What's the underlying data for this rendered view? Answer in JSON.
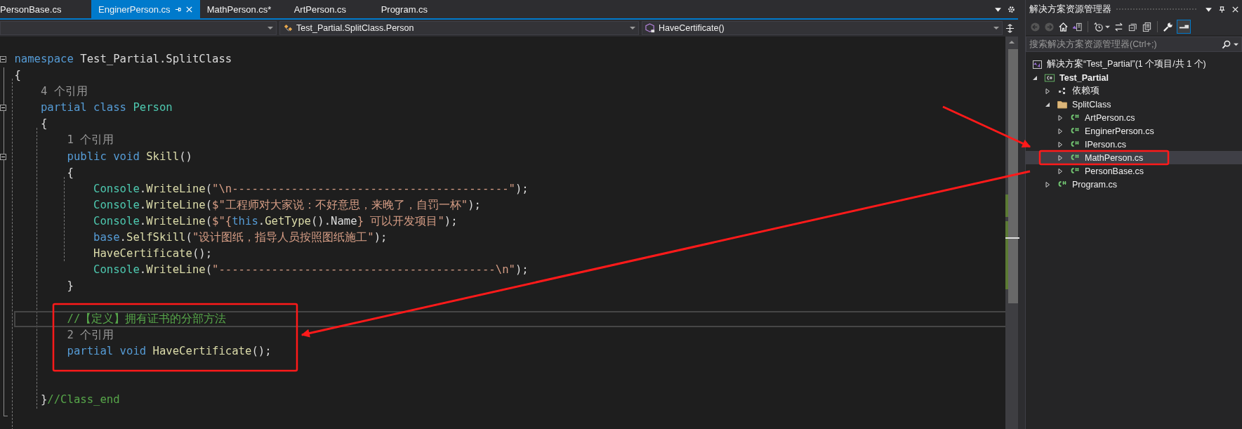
{
  "editor": {
    "tabs": [
      {
        "label": "PersonBase.cs",
        "selected": false
      },
      {
        "label": "EnginerPerson.cs",
        "selected": true
      },
      {
        "label": "MathPerson.cs*",
        "selected": false
      },
      {
        "label": "ArtPerson.cs",
        "selected": false
      },
      {
        "label": "Program.cs",
        "selected": false
      }
    ],
    "nav_bar": {
      "type": "Test_Partial.SplitClass.Person",
      "member": "HaveCertificate()"
    },
    "lines": [
      {
        "kind": "code",
        "fold": true,
        "current": false,
        "segments": [
          {
            "text": "namespace",
            "kind": "keyword"
          },
          {
            "text": " Test_Partial.SplitClass",
            "kind": "plain"
          }
        ]
      },
      {
        "kind": "code",
        "fold": false,
        "current": false,
        "segments": [
          {
            "text": "{",
            "kind": "plain"
          }
        ]
      },
      {
        "kind": "codelens",
        "fold": false,
        "current": false,
        "segments": [
          {
            "text": "    4 个引用",
            "kind": "lens"
          }
        ]
      },
      {
        "kind": "code",
        "fold": true,
        "current": false,
        "segments": [
          {
            "text": "    partial class",
            "kind": "keyword"
          },
          {
            "text": " Person",
            "kind": "type"
          }
        ]
      },
      {
        "kind": "code",
        "fold": false,
        "current": false,
        "segments": [
          {
            "text": "    {",
            "kind": "plain"
          }
        ]
      },
      {
        "kind": "codelens",
        "fold": false,
        "current": false,
        "segments": [
          {
            "text": "        1 个引用",
            "kind": "lens"
          }
        ]
      },
      {
        "kind": "code",
        "fold": true,
        "current": false,
        "segments": [
          {
            "text": "        public void",
            "kind": "keyword"
          },
          {
            "text": " Skill",
            "kind": "method"
          },
          {
            "text": "()",
            "kind": "plain"
          }
        ]
      },
      {
        "kind": "code",
        "fold": false,
        "current": false,
        "segments": [
          {
            "text": "        {",
            "kind": "plain"
          }
        ]
      },
      {
        "kind": "code",
        "fold": false,
        "current": false,
        "segments": [
          {
            "text": "            Console",
            "kind": "type"
          },
          {
            "text": ".",
            "kind": "plain"
          },
          {
            "text": "WriteLine",
            "kind": "method"
          },
          {
            "text": "(",
            "kind": "plain"
          },
          {
            "text": "\"\\n------------------------------------------\"",
            "kind": "string"
          },
          {
            "text": ");",
            "kind": "plain"
          }
        ]
      },
      {
        "kind": "code",
        "fold": false,
        "current": false,
        "segments": [
          {
            "text": "            Console",
            "kind": "type"
          },
          {
            "text": ".",
            "kind": "plain"
          },
          {
            "text": "WriteLine",
            "kind": "method"
          },
          {
            "text": "(",
            "kind": "plain"
          },
          {
            "text": "$\"工程师对大家说：不好意思，来晚了，自罚一杯\"",
            "kind": "string"
          },
          {
            "text": ");",
            "kind": "plain"
          }
        ]
      },
      {
        "kind": "code",
        "fold": false,
        "current": false,
        "segments": [
          {
            "text": "            Console",
            "kind": "type"
          },
          {
            "text": ".",
            "kind": "plain"
          },
          {
            "text": "WriteLine",
            "kind": "method"
          },
          {
            "text": "(",
            "kind": "plain"
          },
          {
            "text": "$\"{",
            "kind": "string"
          },
          {
            "text": "this",
            "kind": "keyword"
          },
          {
            "text": ".",
            "kind": "plain"
          },
          {
            "text": "GetType",
            "kind": "method"
          },
          {
            "text": "().Name",
            "kind": "plain"
          },
          {
            "text": "} 可以开发项目\"",
            "kind": "string"
          },
          {
            "text": ");",
            "kind": "plain"
          }
        ]
      },
      {
        "kind": "code",
        "fold": false,
        "current": false,
        "segments": [
          {
            "text": "            base",
            "kind": "keyword"
          },
          {
            "text": ".",
            "kind": "plain"
          },
          {
            "text": "SelfSkill",
            "kind": "method"
          },
          {
            "text": "(",
            "kind": "plain"
          },
          {
            "text": "\"设计图纸，指导人员按照图纸施工\"",
            "kind": "string"
          },
          {
            "text": ");",
            "kind": "plain"
          }
        ]
      },
      {
        "kind": "code",
        "fold": false,
        "current": false,
        "segments": [
          {
            "text": "            HaveCertificate",
            "kind": "method"
          },
          {
            "text": "();",
            "kind": "plain"
          }
        ]
      },
      {
        "kind": "code",
        "fold": false,
        "current": false,
        "segments": [
          {
            "text": "            Console",
            "kind": "type"
          },
          {
            "text": ".",
            "kind": "plain"
          },
          {
            "text": "WriteLine",
            "kind": "method"
          },
          {
            "text": "(",
            "kind": "plain"
          },
          {
            "text": "\"------------------------------------------\\n\"",
            "kind": "string"
          },
          {
            "text": ");",
            "kind": "plain"
          }
        ]
      },
      {
        "kind": "code",
        "fold": false,
        "current": false,
        "segments": [
          {
            "text": "        }",
            "kind": "plain"
          }
        ]
      },
      {
        "kind": "blank"
      },
      {
        "kind": "code",
        "fold": false,
        "current": true,
        "segments": [
          {
            "text": "        //【定义】拥有证书的分部方法",
            "kind": "comment"
          }
        ]
      },
      {
        "kind": "codelens",
        "fold": false,
        "current": false,
        "segments": [
          {
            "text": "        2 个引用",
            "kind": "lens"
          }
        ]
      },
      {
        "kind": "code",
        "fold": false,
        "current": false,
        "segments": [
          {
            "text": "        partial void",
            "kind": "keyword"
          },
          {
            "text": " HaveCertificate",
            "kind": "method"
          },
          {
            "text": "();",
            "kind": "plain"
          }
        ]
      },
      {
        "kind": "blank"
      },
      {
        "kind": "blank"
      },
      {
        "kind": "code",
        "fold": false,
        "current": false,
        "segments": [
          {
            "text": "    }",
            "kind": "plain"
          },
          {
            "text": "//Class_end",
            "kind": "comment"
          }
        ]
      }
    ]
  },
  "solution_explorer": {
    "title": "解决方案资源管理器",
    "search": {
      "placeholder": "搜索解决方案资源管理器(Ctrl+;)"
    },
    "tree": [
      {
        "label": "解决方案“Test_Partial”(1 个项目/共 1 个)",
        "kind": "solution",
        "selected": false,
        "children": [
          {
            "label": "Test_Partial",
            "kind": "project",
            "expanded": true,
            "selected": false,
            "children": [
              {
                "label": "依赖项",
                "kind": "dependencies",
                "expanded": false,
                "selected": false
              },
              {
                "label": "SplitClass",
                "kind": "folder",
                "expanded": true,
                "selected": false,
                "children": [
                  {
                    "label": "ArtPerson.cs",
                    "kind": "file",
                    "expanded": false,
                    "selected": false
                  },
                  {
                    "label": "EnginerPerson.cs",
                    "kind": "file",
                    "expanded": false,
                    "selected": false
                  },
                  {
                    "label": "IPerson.cs",
                    "kind": "file",
                    "expanded": false,
                    "selected": false
                  },
                  {
                    "label": "MathPerson.cs",
                    "kind": "file",
                    "expanded": false,
                    "selected": true
                  },
                  {
                    "label": "PersonBase.cs",
                    "kind": "file",
                    "expanded": false,
                    "selected": false
                  }
                ]
              },
              {
                "label": "Program.cs",
                "kind": "file",
                "expanded": false,
                "selected": false
              }
            ]
          }
        ]
      }
    ]
  }
}
